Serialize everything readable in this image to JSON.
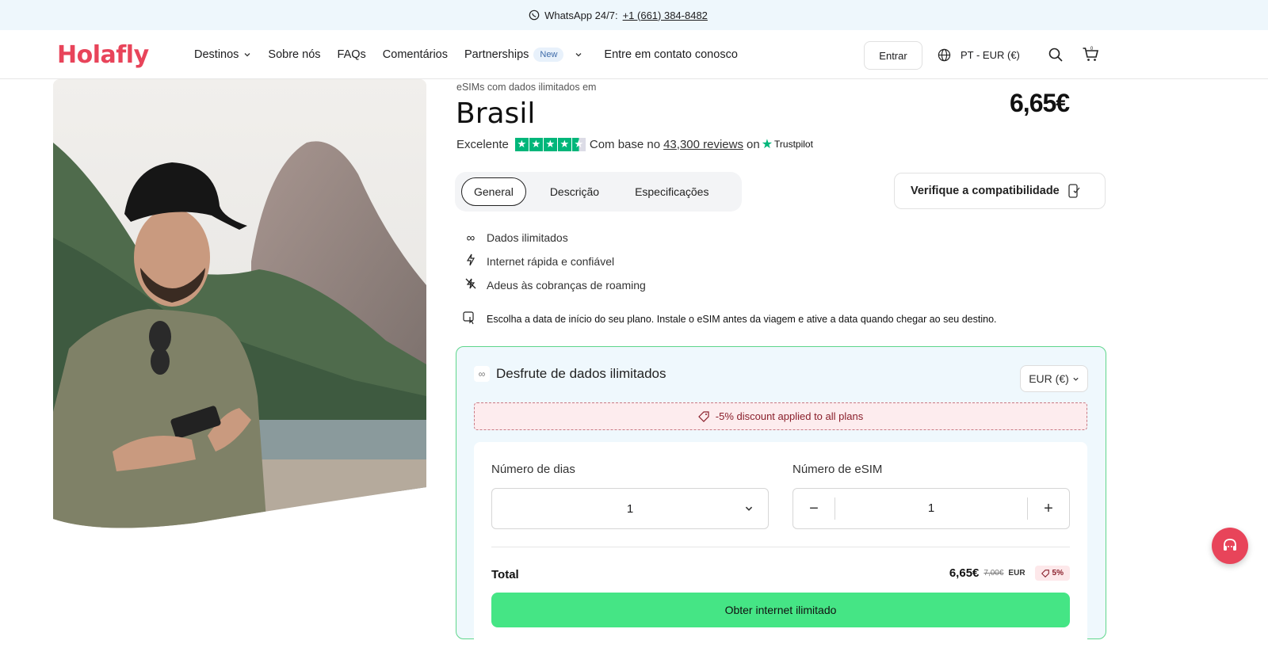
{
  "topbar": {
    "whatsapp_label": "WhatsApp 24/7:",
    "phone": "+1 (661) 384-8482"
  },
  "nav": {
    "logo": "Holafly",
    "links": {
      "destinos": "Destinos",
      "sobre": "Sobre nós",
      "faqs": "FAQs",
      "comentarios": "Comentários",
      "partnerships": "Partnerships",
      "partnerships_badge": "New",
      "contato": "Entre em contato conosco"
    },
    "login": "Entrar",
    "locale": "PT - EUR (€)",
    "cart_count": "0"
  },
  "product": {
    "subtitle": "eSIMs com dados ilimitados em",
    "title": "Brasil",
    "price": "6,65€",
    "rating": {
      "label": "Excelente",
      "stars": 4.5,
      "based_on": "Com base no",
      "reviews": "43,300 reviews",
      "on": "on",
      "provider": "Trustpilot"
    }
  },
  "tabs": [
    "General",
    "Descrição",
    "Especificações"
  ],
  "compat_button": "Verifique a compatibilidade",
  "features": [
    {
      "icon": "infinity-icon",
      "text": "Dados ilimitados"
    },
    {
      "icon": "lightning-icon",
      "text": "Internet rápida e confiável"
    },
    {
      "icon": "no-roaming-icon",
      "text": "Adeus às cobranças de roaming"
    }
  ],
  "note": "Escolha a data de início do seu plano. Instale o eSIM antes da viagem e ative a data quando chegar ao seu destino.",
  "plan": {
    "heading": "Desfrute de dados ilimitados",
    "currency": "EUR (€)",
    "discount_text": "-5% discount applied to all plans",
    "days_label": "Número de dias",
    "days_value": "1",
    "esim_label": "Número de eSIM",
    "esim_value": "1",
    "total_label": "Total",
    "total_price": "6,65€",
    "old_price": "7,00€",
    "currency_code": "EUR",
    "discount_badge": "5%",
    "cta": "Obter internet ilimitado"
  },
  "colors": {
    "brand": "#e8445a",
    "cta": "#45e585",
    "trustpilot": "#00b67a",
    "plan_border": "#5fd68c"
  }
}
